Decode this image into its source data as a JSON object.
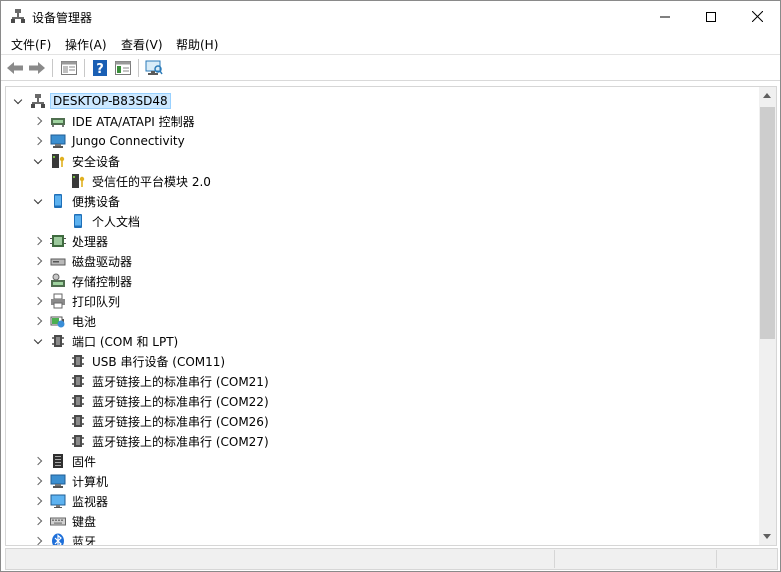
{
  "window": {
    "title": "设备管理器"
  },
  "menu": {
    "file": "文件(F)",
    "action": "操作(A)",
    "view": "查看(V)",
    "help": "帮助(H)"
  },
  "tree": {
    "root": "DESKTOP-B83SD48",
    "items": [
      {
        "label": "IDE ATA/ATAPI 控制器",
        "expanded": false
      },
      {
        "label": "Jungo Connectivity",
        "expanded": false
      },
      {
        "label": "安全设备",
        "expanded": true,
        "children": [
          "受信任的平台模块 2.0"
        ]
      },
      {
        "label": "便携设备",
        "expanded": true,
        "children": [
          "个人文档"
        ]
      },
      {
        "label": "处理器",
        "expanded": false
      },
      {
        "label": "磁盘驱动器",
        "expanded": false
      },
      {
        "label": "存储控制器",
        "expanded": false
      },
      {
        "label": "打印队列",
        "expanded": false
      },
      {
        "label": "电池",
        "expanded": false
      },
      {
        "label": "端口 (COM 和 LPT)",
        "expanded": true,
        "children": [
          "USB 串行设备 (COM11)",
          "蓝牙链接上的标准串行 (COM21)",
          "蓝牙链接上的标准串行 (COM22)",
          "蓝牙链接上的标准串行 (COM26)",
          "蓝牙链接上的标准串行 (COM27)"
        ]
      },
      {
        "label": "固件",
        "expanded": false
      },
      {
        "label": "计算机",
        "expanded": false
      },
      {
        "label": "监视器",
        "expanded": false
      },
      {
        "label": "键盘",
        "expanded": false
      },
      {
        "label": "蓝牙",
        "expanded": false
      }
    ]
  },
  "icons": {
    "app": "device-manager-icon",
    "back": "back-arrow-icon",
    "forward": "forward-arrow-icon",
    "properties": "properties-icon",
    "help": "help-icon",
    "show_hide": "show-hide-console-icon",
    "scan": "scan-hardware-icon"
  },
  "colors": {
    "selection": "#cce8ff",
    "selection_border": "#99d1ff",
    "help_blue": "#1a5fb4"
  }
}
